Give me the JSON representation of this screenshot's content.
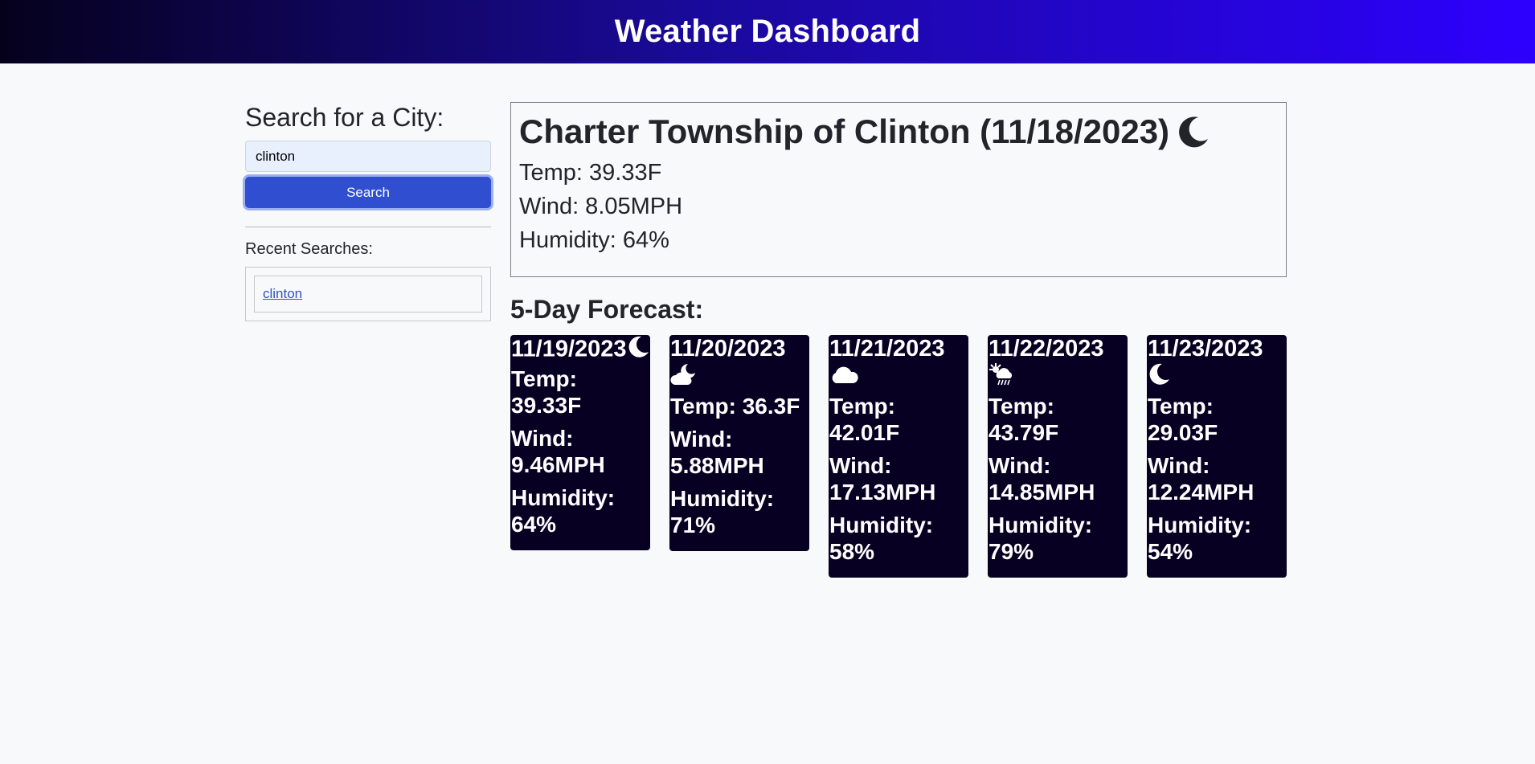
{
  "header": {
    "title": "Weather Dashboard"
  },
  "sidebar": {
    "heading": "Search for a City:",
    "search_value": "clinton",
    "search_button": "Search",
    "recent_title": "Recent Searches:",
    "recent_items": [
      "clinton"
    ]
  },
  "current": {
    "title": "Charter Township of Clinton (11/18/2023)",
    "icon": "moon-icon",
    "temp": "Temp: 39.33F",
    "wind": "Wind: 8.05MPH",
    "humidity": "Humidity: 64%"
  },
  "forecast": {
    "title": "5-Day Forecast:",
    "days": [
      {
        "date": "11/19/2023",
        "icon": "moon-icon",
        "temp": "Temp: 39.33F",
        "wind": "Wind: 9.46MPH",
        "humidity": "Humidity: 64%"
      },
      {
        "date": "11/20/2023",
        "icon": "cloud-moon-icon",
        "temp": "Temp: 36.3F",
        "wind": "Wind: 5.88MPH",
        "humidity": "Humidity: 71%"
      },
      {
        "date": "11/21/2023",
        "icon": "cloud-icon",
        "temp": "Temp: 42.01F",
        "wind": "Wind: 17.13MPH",
        "humidity": "Humidity: 58%"
      },
      {
        "date": "11/22/2023",
        "icon": "cloud-sun-rain-icon",
        "temp": "Temp: 43.79F",
        "wind": "Wind: 14.85MPH",
        "humidity": "Humidity: 79%"
      },
      {
        "date": "11/23/2023",
        "icon": "moon-icon",
        "temp": "Temp: 29.03F",
        "wind": "Wind: 12.24MPH",
        "humidity": "Humidity: 54%"
      }
    ]
  },
  "colors": {
    "header_gradient_start": "#05011c",
    "header_gradient_end": "#2d00ff",
    "button": "#2f4fd0",
    "card_bg": "#080022",
    "page_bg": "#f8f9fa"
  }
}
